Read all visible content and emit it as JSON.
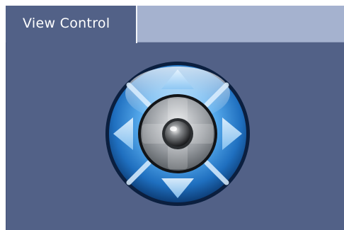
{
  "tabs": [
    {
      "label": "View Control",
      "active": true
    }
  ],
  "view_control": {
    "controls": [
      "up-arrow-icon",
      "down-arrow-icon",
      "left-arrow-icon",
      "right-arrow-icon",
      "center-home-icon"
    ]
  },
  "colors": {
    "panel_background": "#526187",
    "tab_strip": "#a5b2cf",
    "ring_blue": "#2e7fd0",
    "center_gray": "#8c9094"
  }
}
